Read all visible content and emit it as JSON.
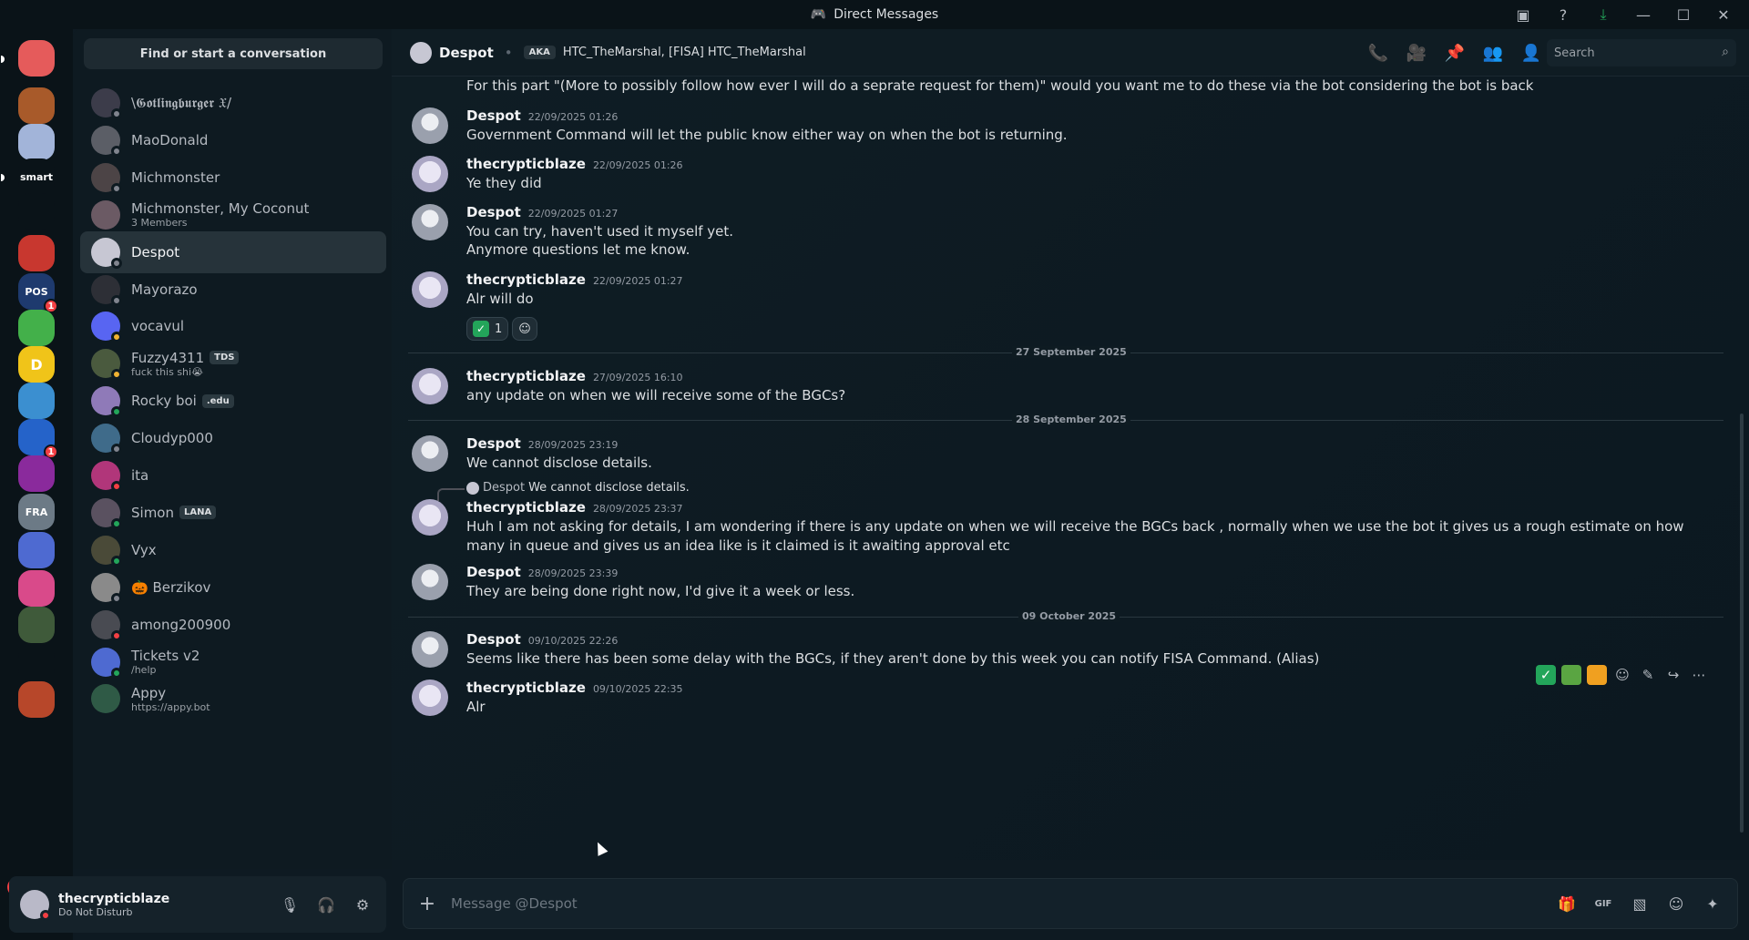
{
  "window": {
    "title": "Direct Messages",
    "title_icon": "discord-icon",
    "controls": [
      "inbox-icon",
      "help-icon",
      "download-icon",
      "minimize",
      "maximize",
      "close"
    ]
  },
  "rail": {
    "new_badge": "NEW",
    "servers": [
      {
        "name": "discord-home",
        "color": "#e55b5b",
        "label": ""
      },
      {
        "name": "server-cookie",
        "color": "#a85a2a",
        "label": ""
      },
      {
        "name": "server-anime",
        "color": "#a2b4d9",
        "label": ""
      },
      {
        "name": "server-smart",
        "color": "#0a1318",
        "label": "smart"
      },
      {
        "name": "server-dark",
        "color": "#0a1318",
        "label": ""
      },
      {
        "name": "server-apple",
        "color": "#c8372f",
        "label": ""
      },
      {
        "name": "server-easypos",
        "color": "#1e3a6e",
        "label": "POS",
        "badge": "1"
      },
      {
        "name": "server-parrot",
        "color": "#43b04a",
        "label": ""
      },
      {
        "name": "server-d",
        "color": "#f0c419",
        "label": "D"
      },
      {
        "name": "server-blue",
        "color": "#3b8fd0",
        "label": ""
      },
      {
        "name": "server-cog",
        "color": "#2563c9",
        "label": "",
        "badge": "1"
      },
      {
        "name": "server-heart",
        "color": "#8a2a9c",
        "label": ""
      },
      {
        "name": "server-fra",
        "color": "#6c7a86",
        "label": "FRA"
      },
      {
        "name": "server-ticket",
        "color": "#4e6ad1",
        "label": ""
      },
      {
        "name": "server-rainbow",
        "color": "#d94a8a",
        "label": ""
      },
      {
        "name": "server-person",
        "color": "#3f5a3a",
        "label": ""
      },
      {
        "name": "server-folder",
        "color": "#0a1318",
        "label": ""
      },
      {
        "name": "server-new",
        "color": "#b7472a",
        "label": ""
      }
    ]
  },
  "sidebar": {
    "search_label": "Find or start a conversation",
    "dms": [
      {
        "name": "\\𝕲𝖔𝖙𝖑𝖎𝖓𝖌𝖇𝖚𝖗𝖌𝖊𝖗 𝔛/",
        "sub": "",
        "status": "off",
        "avatar": "#3c3c4a",
        "tag": ""
      },
      {
        "name": "MaoDonald",
        "sub": "",
        "status": "off",
        "avatar": "#5b5e66",
        "tag": ""
      },
      {
        "name": "Michmonster",
        "sub": "",
        "status": "off",
        "avatar": "#4c4446",
        "tag": ""
      },
      {
        "name": "Michmonster, My Coconut",
        "sub": "3 Members",
        "status": "",
        "avatar": "#6b5a64",
        "tag": ""
      },
      {
        "name": "Despot",
        "sub": "",
        "status": "off",
        "avatar": "#c7c7d3",
        "tag": "",
        "active": true
      },
      {
        "name": "Mayorazo",
        "sub": "",
        "status": "off",
        "avatar": "#2d2f36",
        "tag": ""
      },
      {
        "name": "vocavul",
        "sub": "",
        "status": "idle",
        "avatar": "#5865f2",
        "tag": ""
      },
      {
        "name": "Fuzzy4311",
        "sub": "fuck this shi😭",
        "status": "idle",
        "avatar": "#4a5a3e",
        "tag": "TDS"
      },
      {
        "name": "Rocky boi",
        "sub": "",
        "status": "on",
        "avatar": "#8f7ab8",
        "tag": ".edu"
      },
      {
        "name": "Cloudyp000",
        "sub": "",
        "status": "off",
        "avatar": "#3f6b8a",
        "tag": ""
      },
      {
        "name": "ita",
        "sub": "",
        "status": "dnd",
        "avatar": "#b1367a",
        "tag": ""
      },
      {
        "name": "Simon",
        "sub": "",
        "status": "on",
        "avatar": "#5a5160",
        "tag": "LANA"
      },
      {
        "name": "Vyx",
        "sub": "",
        "status": "on",
        "avatar": "#4a4a38",
        "tag": ""
      },
      {
        "name": "🎃 Berzikov",
        "sub": "",
        "status": "off",
        "avatar": "#8a8a8a",
        "tag": ""
      },
      {
        "name": "among200900",
        "sub": "",
        "status": "dnd",
        "avatar": "#494b52",
        "tag": ""
      },
      {
        "name": "Tickets v2",
        "sub": "/help",
        "status": "on",
        "avatar": "#4e6ad1",
        "tag": ""
      },
      {
        "name": "Appy",
        "sub": "https://appy.bot",
        "status": "",
        "avatar": "#2f5a46",
        "tag": ""
      }
    ]
  },
  "user": {
    "name": "thecrypticblaze",
    "status": "Do Not Disturb"
  },
  "header": {
    "name": "Despot",
    "aka_badge": "AKA",
    "aka_value": "HTC_TheMarshal, [FISA] HTC_TheMarshal",
    "search_placeholder": "Search",
    "icons": [
      "phone-icon",
      "video-icon",
      "pin-icon",
      "add-friend-icon",
      "profile-icon"
    ]
  },
  "messages": {
    "top_continuation": "For this part \"(More to possibly follow how ever I will do a seprate request for them)\" would you want me to do these via the bot considering the bot is back",
    "m1": {
      "author": "Despot",
      "time": "22/09/2025 01:26",
      "text": "Government Command will let the public know either way on when the bot is returning."
    },
    "m2": {
      "author": "thecrypticblaze",
      "time": "22/09/2025 01:26",
      "text": "Ye they did"
    },
    "m3": {
      "author": "Despot",
      "time": "22/09/2025 01:27",
      "text": "You can try, haven't used it myself yet.",
      "cont": "Anymore questions let me know."
    },
    "m4": {
      "author": "thecrypticblaze",
      "time": "22/09/2025 01:27",
      "text": "Alr will do",
      "reaction_count": "1"
    },
    "div1": "27 September 2025",
    "m5": {
      "author": "thecrypticblaze",
      "time": "27/09/2025 16:10",
      "text": "any update on when we will receive some of the BGCs?"
    },
    "div2": "28 September 2025",
    "m6": {
      "author": "Despot",
      "time": "28/09/2025 23:19",
      "text": "We cannot disclose details."
    },
    "reply": {
      "author": "Despot",
      "text": "We cannot disclose details."
    },
    "m7": {
      "author": "thecrypticblaze",
      "time": "28/09/2025 23:37",
      "text": "Huh I am not asking for details, I am wondering if there is any update on when we will receive the BGCs back , normally when we use the bot it gives us a rough estimate on how many in queue and gives us an idea like is it claimed is it awaiting approval etc"
    },
    "m8": {
      "author": "Despot",
      "time": "28/09/2025 23:39",
      "text": "They are being done right now, I'd give it a week or less."
    },
    "div3": "09 October 2025",
    "m9": {
      "author": "Despot",
      "time": "09/10/2025 22:26",
      "text": "Seems like there has been some delay with the BGCs, if they aren't done by this week you can notify FISA Command. (Alias)"
    },
    "m10": {
      "author": "thecrypticblaze",
      "time": "09/10/2025 22:35",
      "text": "Alr"
    }
  },
  "composer": {
    "placeholder": "Message @Despot",
    "tools": [
      "gift-icon",
      "gif-icon",
      "sticker-icon",
      "emoji-icon",
      "apps-icon"
    ],
    "gif_label": "GIF"
  }
}
